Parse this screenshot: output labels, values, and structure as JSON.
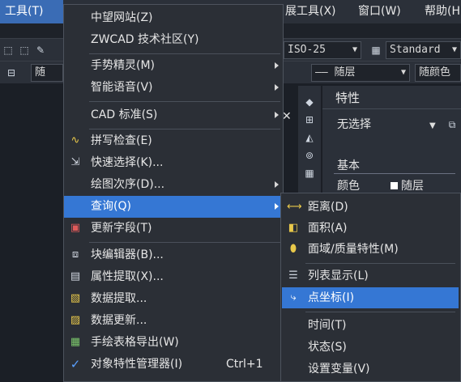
{
  "menubar": {
    "tools": "工具(T)",
    "express": "展工具(X)",
    "window": "窗口(W)",
    "help": "帮助(H"
  },
  "toolbar": {
    "dimstyle": "ISO-25",
    "tablestyle": "Standard",
    "layer_color": "随",
    "linetype": "—— 随层",
    "color": "随颜色"
  },
  "properties": {
    "title": "特性",
    "selection": "无选择",
    "section_basic": "基本",
    "color_label": "颜色",
    "color_value": "随层"
  },
  "tools_menu": {
    "items": [
      {
        "label": "中望网站(Z)",
        "icon": "",
        "submenu": false,
        "shortcut": ""
      },
      {
        "label": "ZWCAD 技术社区(Y)",
        "icon": "",
        "submenu": false,
        "shortcut": ""
      },
      {
        "label": "手势精灵(M)",
        "icon": "",
        "submenu": true,
        "shortcut": ""
      },
      {
        "label": "智能语音(V)",
        "icon": "",
        "submenu": true,
        "shortcut": ""
      },
      {
        "label": "CAD 标准(S)",
        "icon": "",
        "submenu": true,
        "shortcut": ""
      },
      {
        "label": "拼写检查(E)",
        "icon": "spell-check-icon",
        "submenu": false,
        "shortcut": ""
      },
      {
        "label": "快速选择(K)...",
        "icon": "quick-select-icon",
        "submenu": false,
        "shortcut": ""
      },
      {
        "label": "绘图次序(D)...",
        "icon": "",
        "submenu": true,
        "shortcut": ""
      },
      {
        "label": "查询(Q)",
        "icon": "",
        "submenu": true,
        "shortcut": ""
      },
      {
        "label": "更新字段(T)",
        "icon": "update-field-icon",
        "submenu": false,
        "shortcut": ""
      },
      {
        "label": "块编辑器(B)...",
        "icon": "block-editor-icon",
        "submenu": false,
        "shortcut": ""
      },
      {
        "label": "属性提取(X)...",
        "icon": "attribute-extract-icon",
        "submenu": false,
        "shortcut": ""
      },
      {
        "label": "数据提取...",
        "icon": "data-extract-icon",
        "submenu": false,
        "shortcut": ""
      },
      {
        "label": "数据更新...",
        "icon": "data-update-icon",
        "submenu": false,
        "shortcut": ""
      },
      {
        "label": "手绘表格导出(W)",
        "icon": "table-export-icon",
        "submenu": false,
        "shortcut": ""
      },
      {
        "label": "对象特性管理器(I)",
        "icon": "check-icon",
        "submenu": false,
        "shortcut": "Ctrl+1"
      }
    ],
    "highlighted": "查询(Q)"
  },
  "query_submenu": {
    "items": [
      {
        "label": "距离(D)",
        "icon": "distance-icon"
      },
      {
        "label": "面积(A)",
        "icon": "area-icon"
      },
      {
        "label": "面域/质量特性(M)",
        "icon": "mass-properties-icon"
      },
      {
        "label": "列表显示(L)",
        "icon": "list-icon"
      },
      {
        "label": "点坐标(I)",
        "icon": "point-coordinate-icon"
      },
      {
        "label": "时间(T)",
        "icon": ""
      },
      {
        "label": "状态(S)",
        "icon": ""
      },
      {
        "label": "设置变量(V)",
        "icon": ""
      }
    ],
    "highlighted": "点坐标(I)"
  },
  "colors": {
    "highlight": "#3577d4",
    "menu_bg": "#2b2f36",
    "app_bg": "#1e2229"
  }
}
